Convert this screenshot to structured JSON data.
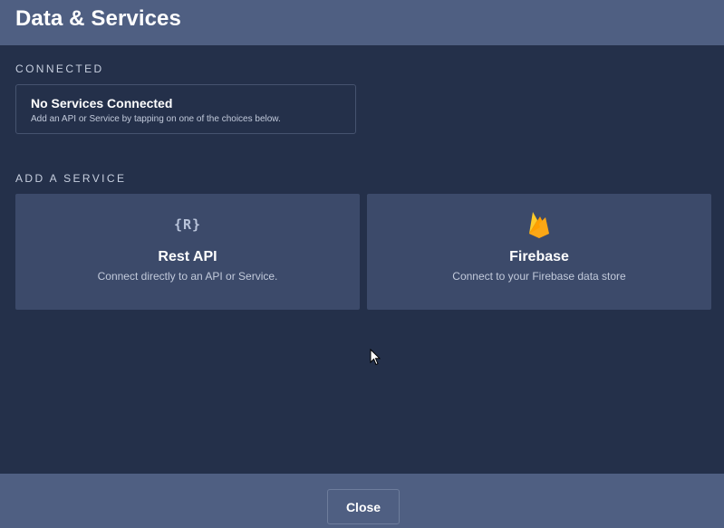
{
  "header": {
    "title": "Data & Services"
  },
  "connected": {
    "label": "CONNECTED",
    "empty_title": "No Services Connected",
    "empty_subtitle": "Add an API or Service by tapping on one of the choices below."
  },
  "add_service": {
    "label": "ADD A SERVICE",
    "options": [
      {
        "title": "Rest API",
        "subtitle": "Connect directly to an API or Service.",
        "icon": "rest-api-icon",
        "icon_text": "{R}"
      },
      {
        "title": "Firebase",
        "subtitle": "Connect to your Firebase data store",
        "icon": "firebase-flame-icon"
      }
    ]
  },
  "footer": {
    "close_label": "Close"
  },
  "colors": {
    "header_bg": "#4f5f82",
    "body_bg": "#24304a",
    "card_bg": "#3c4a6a",
    "firebase_yellow": "#ffca28",
    "firebase_orange": "#f57c00"
  }
}
